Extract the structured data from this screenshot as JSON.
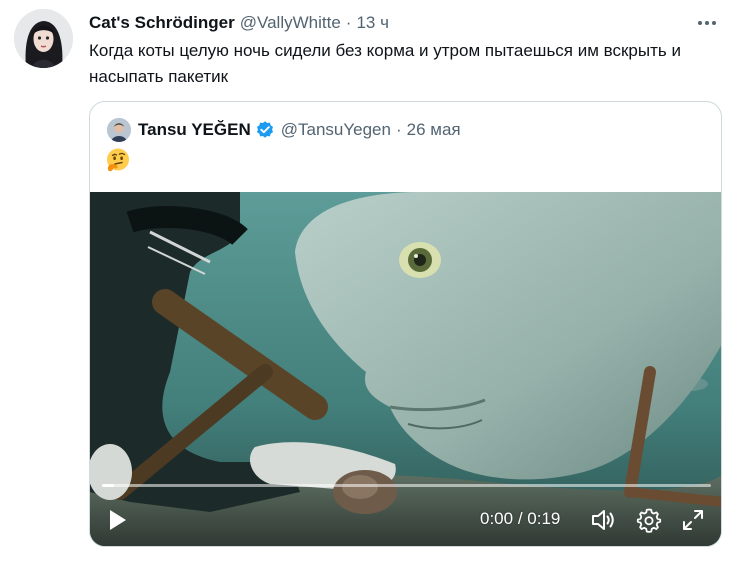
{
  "tweet": {
    "author_name": "Cat's Schrödinger",
    "author_handle": "@VallyWhitte",
    "separator": "·",
    "time": "13 ч",
    "text": "Когда коты целую ночь сидели без корма и утром пытаешься им вскрыть и насыпать пакетик"
  },
  "quote": {
    "author_name": "Tansu YEĞEN",
    "author_handle": "@TansuYegen",
    "separator": "·",
    "date": "26 мая",
    "verified": true,
    "emoji": "thinking-face"
  },
  "video": {
    "current_time": "0:00",
    "time_separator": " / ",
    "duration": "0:19",
    "progress": 0.02
  },
  "colors": {
    "text_primary": "#0f1419",
    "text_secondary": "#536471",
    "border": "#cfd9de",
    "verified_blue": "#1d9bf0",
    "video_water": "#4a8a86"
  },
  "icons": [
    "more-icon",
    "verified-icon",
    "play-icon",
    "volume-icon",
    "settings-gear-icon",
    "fullscreen-icon"
  ]
}
